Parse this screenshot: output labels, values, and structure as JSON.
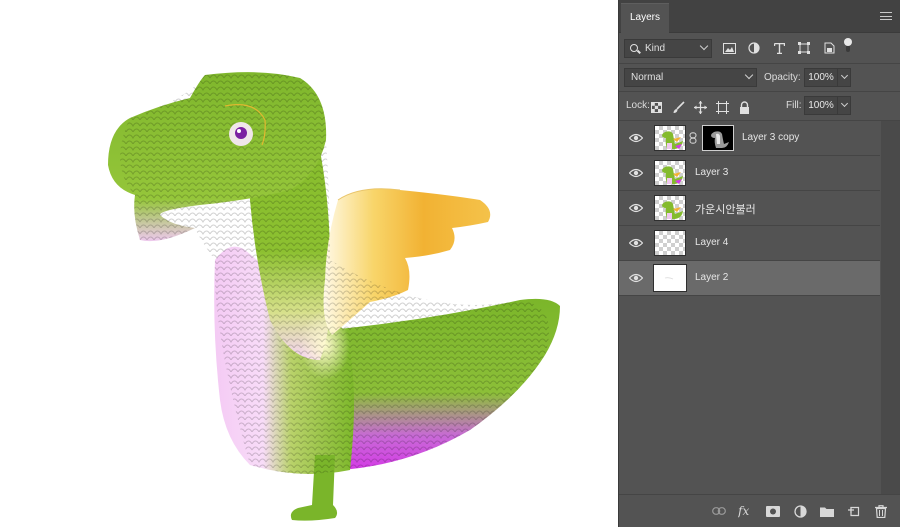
{
  "panel": {
    "tab_label": "Layers",
    "filter": {
      "kind_label": "Kind"
    },
    "blend_mode": "Normal",
    "opacity_label": "Opacity:",
    "opacity_value": "100%",
    "lock_label": "Lock:",
    "fill_label": "Fill:",
    "fill_value": "100%"
  },
  "layers": [
    {
      "name": "Layer 3 copy",
      "has_mask": true,
      "selected": false
    },
    {
      "name": "Layer 3",
      "has_mask": false,
      "selected": false
    },
    {
      "name": "가운시안불러",
      "has_mask": false,
      "selected": false
    },
    {
      "name": "Layer 4",
      "has_mask": false,
      "selected": false
    },
    {
      "name": "Layer 2",
      "has_mask": false,
      "selected": true
    }
  ],
  "colors": {
    "panel_bg": "#535353",
    "selected_row": "#6a6a6a",
    "dragon_green": "#7db82a",
    "dragon_yellow": "#f2b233",
    "dragon_pink": "#f3c6f3",
    "dragon_magenta": "#d43be6"
  }
}
